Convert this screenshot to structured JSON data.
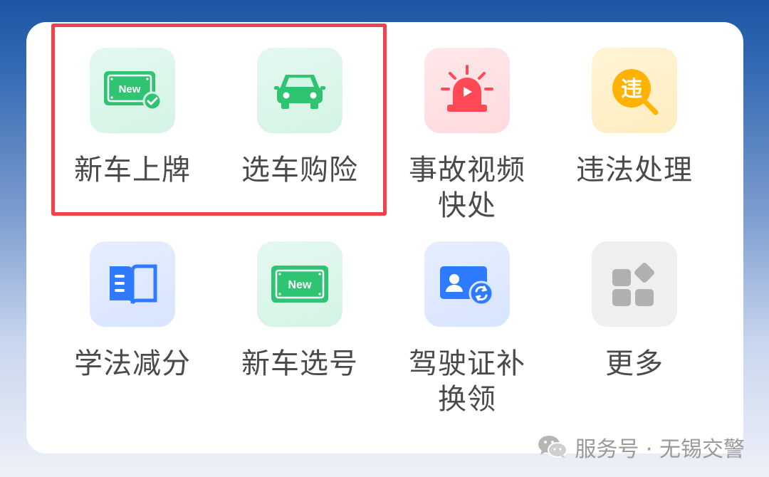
{
  "services": [
    {
      "label": "新车上牌",
      "icon": "new-plate-check-icon"
    },
    {
      "label": "选车购险",
      "icon": "car-icon"
    },
    {
      "label": "事故视频",
      "label2": "快处",
      "icon": "alarm-siren-icon"
    },
    {
      "label": "违法处理",
      "icon": "violation-search-icon",
      "icon_text": "违"
    },
    {
      "label": "学法减分",
      "icon": "book-icon"
    },
    {
      "label": "新车选号",
      "icon": "new-plate-icon"
    },
    {
      "label": "驾驶证补",
      "label2": "换领",
      "icon": "license-renew-icon"
    },
    {
      "label": "更多",
      "icon": "more-apps-icon"
    }
  ],
  "plate_text": "New",
  "watermark": {
    "text": "服务号 · 无锡交警",
    "icon": "wechat-icon"
  },
  "colors": {
    "green": "#2ec472",
    "red": "#ff4a55",
    "yellow": "#ffb300",
    "blue": "#2e7bff",
    "gray": "#b0b0b0",
    "highlight": "#f0434c"
  }
}
